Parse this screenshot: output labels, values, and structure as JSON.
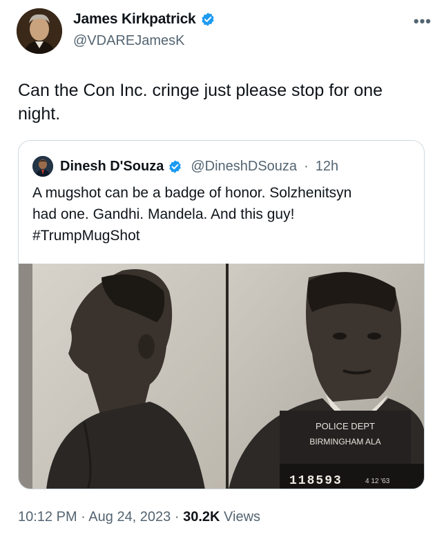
{
  "tweet": {
    "author_name": "James Kirkpatrick",
    "author_handle": "@VDAREJamesK",
    "more_label": "•••",
    "text": "Can the Con Inc. cringe just please stop for one night.",
    "time": "10:12 PM",
    "date": "Aug 24, 2023",
    "views_count": "30.2K",
    "views_label": "Views",
    "separator": "·"
  },
  "quoted": {
    "author_name": "Dinesh D'Souza",
    "author_handle": "@DineshDSouza",
    "separator": "·",
    "time_ago": "12h",
    "text_lines": [
      "A mugshot can be a badge of honor. Solzhenitsyn",
      "had one. Gandhi. Mandela. And this guy!",
      "#TrumpMugShot"
    ],
    "image": {
      "placard_line1": "POLICE DEPT",
      "placard_line2": "BIRMINGHAM ALA",
      "placard_number": "118593",
      "placard_date": "4 12 '63"
    }
  },
  "colors": {
    "verified_badge": "#1d9bf0",
    "secondary_text": "#536471",
    "border": "#cfd9de"
  },
  "icons": [
    "verified-badge-icon",
    "more-icon"
  ]
}
